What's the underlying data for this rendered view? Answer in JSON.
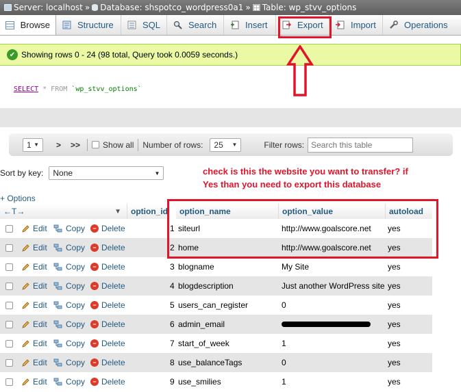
{
  "breadcrumb": {
    "server": "Server: localhost",
    "database": "Database: shspotco_wordpress0a1",
    "table": "Table: wp_stvv_options",
    "separator": "»"
  },
  "tabs": [
    {
      "label": "Browse",
      "icon": "browse-icon"
    },
    {
      "label": "Structure",
      "icon": "structure-icon"
    },
    {
      "label": "SQL",
      "icon": "sql-icon"
    },
    {
      "label": "Search",
      "icon": "search-icon"
    },
    {
      "label": "Insert",
      "icon": "insert-icon"
    },
    {
      "label": "Export",
      "icon": "export-icon"
    },
    {
      "label": "Import",
      "icon": "import-icon"
    },
    {
      "label": "Operations",
      "icon": "wrench-icon"
    }
  ],
  "status": {
    "message": "Showing rows 0 - 24 (98 total, Query took 0.0059 seconds.)"
  },
  "sql": {
    "select": "SELECT",
    "rest": " * FROM ",
    "table": "`wp_stvv_options`"
  },
  "navigation": {
    "page": "1",
    "next": ">",
    "last": ">>",
    "show_all": "Show all",
    "rows_label": "Number of rows:",
    "rows_value": "25",
    "filter_label": "Filter rows:",
    "filter_placeholder": "Search this table"
  },
  "sort": {
    "label": "Sort by key:",
    "value": "None"
  },
  "annotation": {
    "line1": "check is this the website you want to transfer? if",
    "line2": "Yes than you need to export this database"
  },
  "options_link": "+ Options",
  "columns": {
    "option_id": "option_id",
    "option_name": "option_name",
    "option_value": "option_value",
    "autoload": "autoload",
    "resize": "←T→"
  },
  "actions": {
    "edit": "Edit",
    "copy": "Copy",
    "delete": "Delete"
  },
  "rows": [
    {
      "id": "1",
      "name": "siteurl",
      "value": "http://www.goalscore.net",
      "autoload": "yes"
    },
    {
      "id": "2",
      "name": "home",
      "value": "http://www.goalscore.net",
      "autoload": "yes"
    },
    {
      "id": "3",
      "name": "blogname",
      "value": "My Site",
      "autoload": "yes"
    },
    {
      "id": "4",
      "name": "blogdescription",
      "value": "Just another WordPress site",
      "autoload": "yes"
    },
    {
      "id": "5",
      "name": "users_can_register",
      "value": "0",
      "autoload": "yes"
    },
    {
      "id": "6",
      "name": "admin_email",
      "value": "",
      "autoload": "yes"
    },
    {
      "id": "7",
      "name": "start_of_week",
      "value": "1",
      "autoload": "yes"
    },
    {
      "id": "8",
      "name": "use_balanceTags",
      "value": "0",
      "autoload": "yes"
    },
    {
      "id": "9",
      "name": "use_smilies",
      "value": "1",
      "autoload": "yes"
    }
  ],
  "colors": {
    "accent": "#235a81",
    "annotation": "#e0142a",
    "success_bg": "#ebf8a4"
  }
}
